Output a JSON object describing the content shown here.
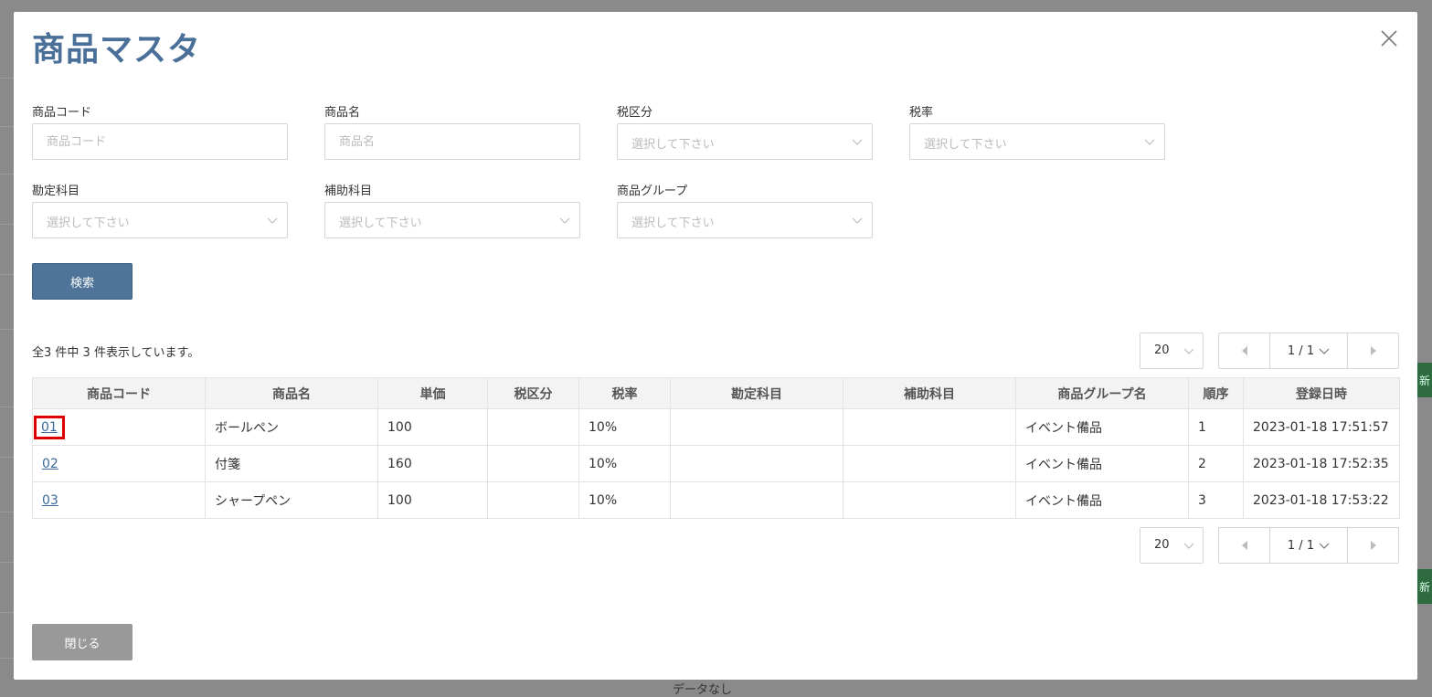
{
  "background": {
    "no_data_text": "データなし",
    "side_buttons": [
      "新",
      "新"
    ]
  },
  "modal": {
    "title": "商品マスタ",
    "close_icon": "close-icon"
  },
  "filters": {
    "product_code": {
      "label": "商品コード",
      "placeholder": "商品コード"
    },
    "product_name": {
      "label": "商品名",
      "placeholder": "商品名"
    },
    "tax_category": {
      "label": "税区分",
      "placeholder": "選択して下さい"
    },
    "tax_rate": {
      "label": "税率",
      "placeholder": "選択して下さい"
    },
    "account": {
      "label": "勘定科目",
      "placeholder": "選択して下さい"
    },
    "sub_account": {
      "label": "補助科目",
      "placeholder": "選択して下さい"
    },
    "product_group": {
      "label": "商品グループ",
      "placeholder": "選択して下さい"
    }
  },
  "search_button": "検索",
  "result_count_text": "全3 件中 3 件表示しています。",
  "pagination": {
    "page_size": "20",
    "current": "1 / 1"
  },
  "table": {
    "headers": [
      "商品コード",
      "商品名",
      "単価",
      "税区分",
      "税率",
      "勘定科目",
      "補助科目",
      "商品グループ名",
      "順序",
      "登録日時"
    ],
    "rows": [
      {
        "code": "01",
        "name": "ボールペン",
        "price": "100",
        "tax_category": "",
        "tax_rate": "10%",
        "account": "",
        "sub_account": "",
        "group": "イベント備品",
        "order": "1",
        "registered": "2023-01-18 17:51:57",
        "highlighted": true
      },
      {
        "code": "02",
        "name": "付箋",
        "price": "160",
        "tax_category": "",
        "tax_rate": "10%",
        "account": "",
        "sub_account": "",
        "group": "イベント備品",
        "order": "2",
        "registered": "2023-01-18 17:52:35",
        "highlighted": false
      },
      {
        "code": "03",
        "name": "シャープペン",
        "price": "100",
        "tax_category": "",
        "tax_rate": "10%",
        "account": "",
        "sub_account": "",
        "group": "イベント備品",
        "order": "3",
        "registered": "2023-01-18 17:53:22",
        "highlighted": false
      }
    ]
  },
  "close_button": "閉じる",
  "colors": {
    "title": "#4a6f98",
    "primary_button": "#4f7499",
    "secondary_button": "#999999",
    "link": "#3a6a9a",
    "highlight_box": "#e00000"
  }
}
